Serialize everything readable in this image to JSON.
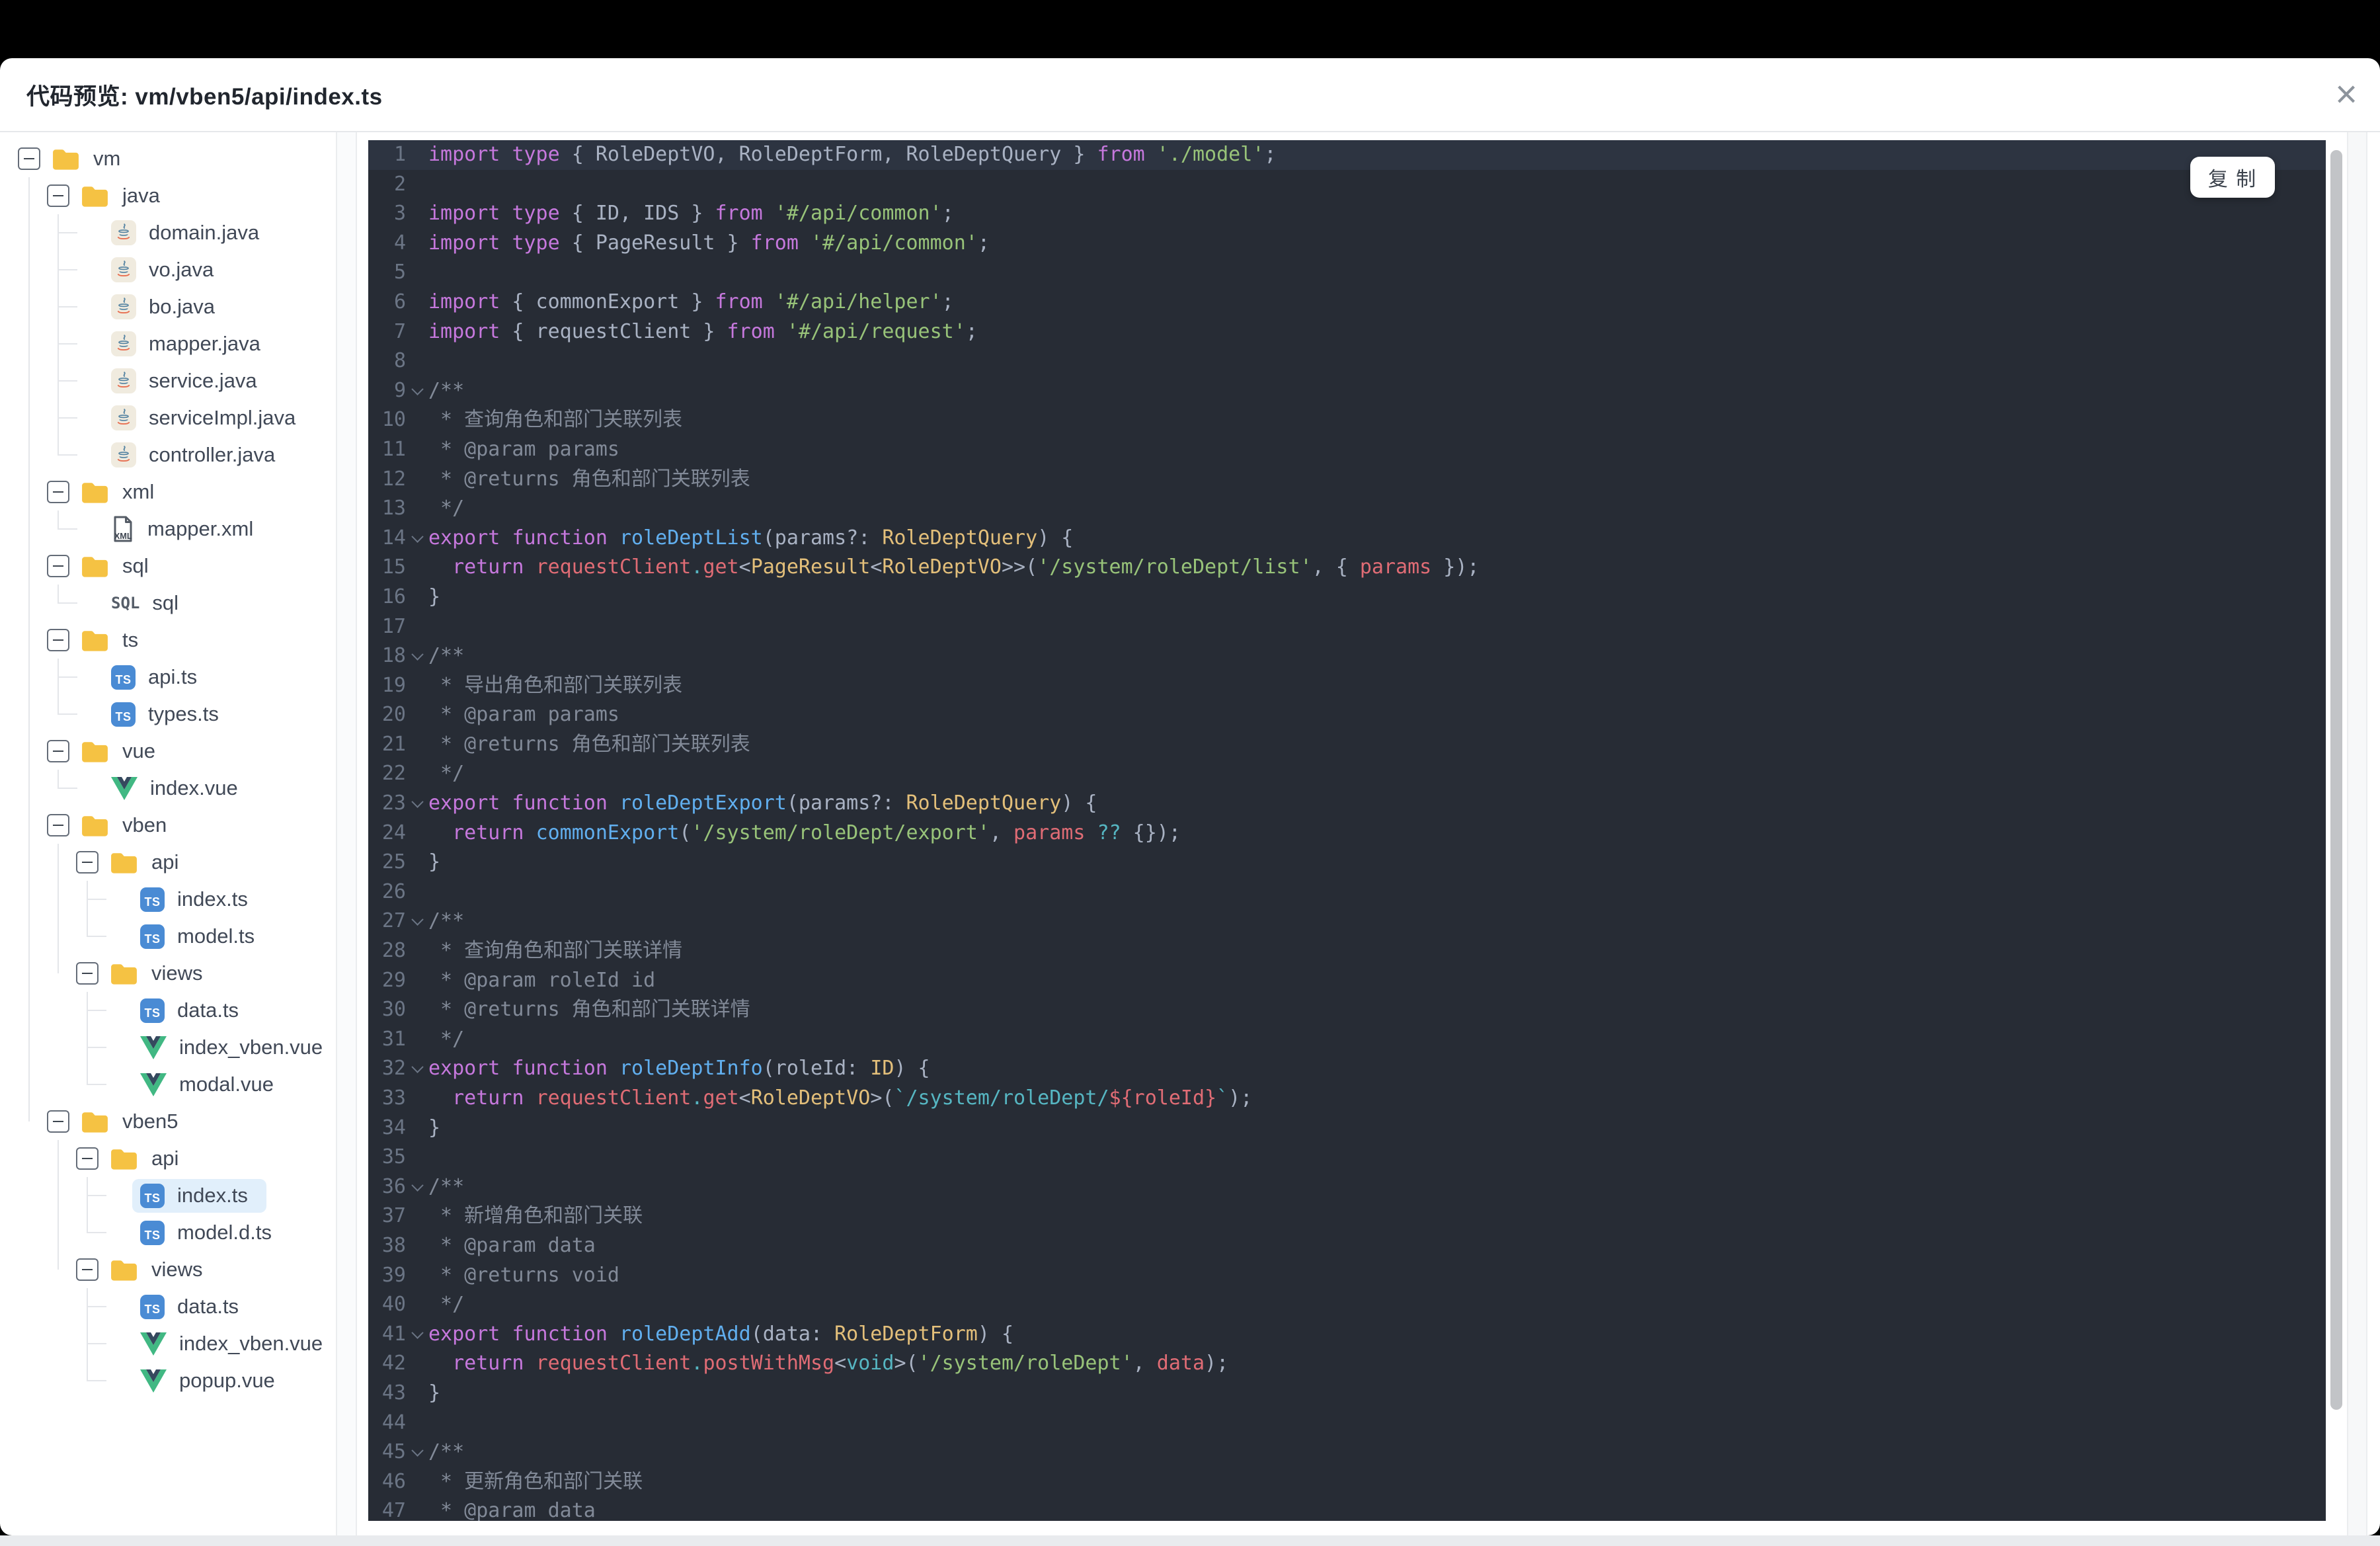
{
  "header": {
    "title": "代码预览: vm/vben5/api/index.ts",
    "close_label": "×"
  },
  "colors": {
    "bg": "#272c35",
    "hlbg": "#2d3441",
    "ln": "#6b7585",
    "default": "#a9b2c3",
    "keyword": "#c678dd",
    "string": "#98c379",
    "type": "#e3bf7a",
    "func": "#61afef",
    "variable": "#e06c75",
    "operator": "#56b6c2",
    "comment": "#828a98",
    "selected_row_bg": "#e1effb",
    "folder_icon": "#f5c243",
    "ts_icon_bg": "#4a8bd4",
    "vue_icon_green": "#41b883",
    "vue_icon_dark": "#35495e"
  },
  "tree": {
    "items": [
      {
        "depth": 0,
        "type": "folder",
        "icon": "folder",
        "label": "vm"
      },
      {
        "depth": 1,
        "type": "folder",
        "icon": "folder",
        "label": "java"
      },
      {
        "depth": 2,
        "type": "file",
        "icon": "java",
        "label": "domain.java"
      },
      {
        "depth": 2,
        "type": "file",
        "icon": "java",
        "label": "vo.java"
      },
      {
        "depth": 2,
        "type": "file",
        "icon": "java",
        "label": "bo.java"
      },
      {
        "depth": 2,
        "type": "file",
        "icon": "java",
        "label": "mapper.java"
      },
      {
        "depth": 2,
        "type": "file",
        "icon": "java",
        "label": "service.java"
      },
      {
        "depth": 2,
        "type": "file",
        "icon": "java",
        "label": "serviceImpl.java"
      },
      {
        "depth": 2,
        "type": "file",
        "icon": "java",
        "label": "controller.java",
        "last": true
      },
      {
        "depth": 1,
        "type": "folder",
        "icon": "folder",
        "label": "xml"
      },
      {
        "depth": 2,
        "type": "file",
        "icon": "xml",
        "label": "mapper.xml",
        "last": true
      },
      {
        "depth": 1,
        "type": "folder",
        "icon": "folder",
        "label": "sql"
      },
      {
        "depth": 2,
        "type": "file",
        "icon": "sql",
        "label": "sql",
        "last": true
      },
      {
        "depth": 1,
        "type": "folder",
        "icon": "folder",
        "label": "ts"
      },
      {
        "depth": 2,
        "type": "file",
        "icon": "ts",
        "label": "api.ts"
      },
      {
        "depth": 2,
        "type": "file",
        "icon": "ts",
        "label": "types.ts",
        "last": true
      },
      {
        "depth": 1,
        "type": "folder",
        "icon": "folder",
        "label": "vue"
      },
      {
        "depth": 2,
        "type": "file",
        "icon": "vue",
        "label": "index.vue",
        "last": true
      },
      {
        "depth": 1,
        "type": "folder",
        "icon": "folder",
        "label": "vben"
      },
      {
        "depth": 2,
        "type": "folder",
        "icon": "folder",
        "label": "api"
      },
      {
        "depth": 3,
        "type": "file",
        "icon": "ts",
        "label": "index.ts"
      },
      {
        "depth": 3,
        "type": "file",
        "icon": "ts",
        "label": "model.ts",
        "last": true
      },
      {
        "depth": 2,
        "type": "folder",
        "icon": "folder",
        "label": "views",
        "last": true
      },
      {
        "depth": 3,
        "type": "file",
        "icon": "ts",
        "label": "data.ts"
      },
      {
        "depth": 3,
        "type": "file",
        "icon": "vue",
        "label": "index_vben.vue"
      },
      {
        "depth": 3,
        "type": "file",
        "icon": "vue",
        "label": "modal.vue",
        "last": true
      },
      {
        "depth": 1,
        "type": "folder",
        "icon": "folder",
        "label": "vben5",
        "last": true
      },
      {
        "depth": 2,
        "type": "folder",
        "icon": "folder",
        "label": "api"
      },
      {
        "depth": 3,
        "type": "file",
        "icon": "ts",
        "label": "index.ts",
        "selected": true
      },
      {
        "depth": 3,
        "type": "file",
        "icon": "ts",
        "label": "model.d.ts",
        "last": true
      },
      {
        "depth": 2,
        "type": "folder",
        "icon": "folder",
        "label": "views",
        "last": true
      },
      {
        "depth": 3,
        "type": "file",
        "icon": "ts",
        "label": "data.ts"
      },
      {
        "depth": 3,
        "type": "file",
        "icon": "vue",
        "label": "index_vben.vue"
      },
      {
        "depth": 3,
        "type": "file",
        "icon": "vue",
        "label": "popup.vue",
        "last": true
      }
    ]
  },
  "code": {
    "copy_label": "复 制",
    "lines": [
      {
        "n": 1,
        "hl": true,
        "segs": [
          [
            "k",
            "import"
          ],
          [
            "d",
            " "
          ],
          [
            "k",
            "type"
          ],
          [
            "d",
            " { RoleDeptVO, RoleDeptForm, RoleDeptQuery } "
          ],
          [
            "k",
            "from"
          ],
          [
            "d",
            " "
          ],
          [
            "s",
            "'./model'"
          ],
          [
            "d",
            ";"
          ]
        ]
      },
      {
        "n": 2,
        "segs": []
      },
      {
        "n": 3,
        "segs": [
          [
            "k",
            "import"
          ],
          [
            "d",
            " "
          ],
          [
            "k",
            "type"
          ],
          [
            "d",
            " { ID, IDS } "
          ],
          [
            "k",
            "from"
          ],
          [
            "d",
            " "
          ],
          [
            "s",
            "'#/api/common'"
          ],
          [
            "d",
            ";"
          ]
        ]
      },
      {
        "n": 4,
        "segs": [
          [
            "k",
            "import"
          ],
          [
            "d",
            " "
          ],
          [
            "k",
            "type"
          ],
          [
            "d",
            " { PageResult } "
          ],
          [
            "k",
            "from"
          ],
          [
            "d",
            " "
          ],
          [
            "s",
            "'#/api/common'"
          ],
          [
            "d",
            ";"
          ]
        ]
      },
      {
        "n": 5,
        "segs": []
      },
      {
        "n": 6,
        "segs": [
          [
            "k",
            "import"
          ],
          [
            "d",
            " { commonExport } "
          ],
          [
            "k",
            "from"
          ],
          [
            "d",
            " "
          ],
          [
            "s",
            "'#/api/helper'"
          ],
          [
            "d",
            ";"
          ]
        ]
      },
      {
        "n": 7,
        "segs": [
          [
            "k",
            "import"
          ],
          [
            "d",
            " { requestClient } "
          ],
          [
            "k",
            "from"
          ],
          [
            "d",
            " "
          ],
          [
            "s",
            "'#/api/request'"
          ],
          [
            "d",
            ";"
          ]
        ]
      },
      {
        "n": 8,
        "segs": []
      },
      {
        "n": 9,
        "fold": true,
        "segs": [
          [
            "m",
            "/**"
          ]
        ]
      },
      {
        "n": 10,
        "segs": [
          [
            "m",
            " * 查询角色和部门关联列表"
          ]
        ]
      },
      {
        "n": 11,
        "segs": [
          [
            "m",
            " * @param params"
          ]
        ]
      },
      {
        "n": 12,
        "segs": [
          [
            "m",
            " * @returns 角色和部门关联列表"
          ]
        ]
      },
      {
        "n": 13,
        "segs": [
          [
            "m",
            " */"
          ]
        ]
      },
      {
        "n": 14,
        "fold": true,
        "segs": [
          [
            "k",
            "export"
          ],
          [
            "d",
            " "
          ],
          [
            "k",
            "function"
          ],
          [
            "d",
            " "
          ],
          [
            "f",
            "roleDeptList"
          ],
          [
            "d",
            "(params?: "
          ],
          [
            "t",
            "RoleDeptQuery"
          ],
          [
            "d",
            ") {"
          ]
        ]
      },
      {
        "n": 15,
        "segs": [
          [
            "d",
            "  "
          ],
          [
            "k",
            "return"
          ],
          [
            "d",
            " "
          ],
          [
            "r",
            "requestClient"
          ],
          [
            "c",
            "."
          ],
          [
            "r",
            "get"
          ],
          [
            "d",
            "<"
          ],
          [
            "t",
            "PageResult"
          ],
          [
            "d",
            "<"
          ],
          [
            "t",
            "RoleDeptVO"
          ],
          [
            "d",
            ">>("
          ],
          [
            "s",
            "'/system/roleDept/list'"
          ],
          [
            "d",
            ", { "
          ],
          [
            "r",
            "params"
          ],
          [
            "d",
            " });"
          ]
        ]
      },
      {
        "n": 16,
        "segs": [
          [
            "d",
            "}"
          ]
        ]
      },
      {
        "n": 17,
        "segs": []
      },
      {
        "n": 18,
        "fold": true,
        "segs": [
          [
            "m",
            "/**"
          ]
        ]
      },
      {
        "n": 19,
        "segs": [
          [
            "m",
            " * 导出角色和部门关联列表"
          ]
        ]
      },
      {
        "n": 20,
        "segs": [
          [
            "m",
            " * @param params"
          ]
        ]
      },
      {
        "n": 21,
        "segs": [
          [
            "m",
            " * @returns 角色和部门关联列表"
          ]
        ]
      },
      {
        "n": 22,
        "segs": [
          [
            "m",
            " */"
          ]
        ]
      },
      {
        "n": 23,
        "fold": true,
        "segs": [
          [
            "k",
            "export"
          ],
          [
            "d",
            " "
          ],
          [
            "k",
            "function"
          ],
          [
            "d",
            " "
          ],
          [
            "f",
            "roleDeptExport"
          ],
          [
            "d",
            "(params?: "
          ],
          [
            "t",
            "RoleDeptQuery"
          ],
          [
            "d",
            ") {"
          ]
        ]
      },
      {
        "n": 24,
        "segs": [
          [
            "d",
            "  "
          ],
          [
            "k",
            "return"
          ],
          [
            "d",
            " "
          ],
          [
            "f",
            "commonExport"
          ],
          [
            "d",
            "("
          ],
          [
            "s",
            "'/system/roleDept/export'"
          ],
          [
            "d",
            ", "
          ],
          [
            "r",
            "params"
          ],
          [
            "d",
            " "
          ],
          [
            "c",
            "??"
          ],
          [
            "d",
            " {});"
          ]
        ]
      },
      {
        "n": 25,
        "segs": [
          [
            "d",
            "}"
          ]
        ]
      },
      {
        "n": 26,
        "segs": []
      },
      {
        "n": 27,
        "fold": true,
        "segs": [
          [
            "m",
            "/**"
          ]
        ]
      },
      {
        "n": 28,
        "segs": [
          [
            "m",
            " * 查询角色和部门关联详情"
          ]
        ]
      },
      {
        "n": 29,
        "segs": [
          [
            "m",
            " * @param roleId id"
          ]
        ]
      },
      {
        "n": 30,
        "segs": [
          [
            "m",
            " * @returns 角色和部门关联详情"
          ]
        ]
      },
      {
        "n": 31,
        "segs": [
          [
            "m",
            " */"
          ]
        ]
      },
      {
        "n": 32,
        "fold": true,
        "segs": [
          [
            "k",
            "export"
          ],
          [
            "d",
            " "
          ],
          [
            "k",
            "function"
          ],
          [
            "d",
            " "
          ],
          [
            "f",
            "roleDeptInfo"
          ],
          [
            "d",
            "(roleId: "
          ],
          [
            "t",
            "ID"
          ],
          [
            "d",
            ") {"
          ]
        ]
      },
      {
        "n": 33,
        "segs": [
          [
            "d",
            "  "
          ],
          [
            "k",
            "return"
          ],
          [
            "d",
            " "
          ],
          [
            "r",
            "requestClient"
          ],
          [
            "c",
            "."
          ],
          [
            "r",
            "get"
          ],
          [
            "d",
            "<"
          ],
          [
            "t",
            "RoleDeptVO"
          ],
          [
            "d",
            ">("
          ],
          [
            "c",
            "`/system/roleDept/"
          ],
          [
            "r",
            "${roleId}"
          ],
          [
            "c",
            "`"
          ],
          [
            "d",
            ");"
          ]
        ]
      },
      {
        "n": 34,
        "segs": [
          [
            "d",
            "}"
          ]
        ]
      },
      {
        "n": 35,
        "segs": []
      },
      {
        "n": 36,
        "fold": true,
        "segs": [
          [
            "m",
            "/**"
          ]
        ]
      },
      {
        "n": 37,
        "segs": [
          [
            "m",
            " * 新增角色和部门关联"
          ]
        ]
      },
      {
        "n": 38,
        "segs": [
          [
            "m",
            " * @param data"
          ]
        ]
      },
      {
        "n": 39,
        "segs": [
          [
            "m",
            " * @returns void"
          ]
        ]
      },
      {
        "n": 40,
        "segs": [
          [
            "m",
            " */"
          ]
        ]
      },
      {
        "n": 41,
        "fold": true,
        "segs": [
          [
            "k",
            "export"
          ],
          [
            "d",
            " "
          ],
          [
            "k",
            "function"
          ],
          [
            "d",
            " "
          ],
          [
            "f",
            "roleDeptAdd"
          ],
          [
            "d",
            "(data: "
          ],
          [
            "t",
            "RoleDeptForm"
          ],
          [
            "d",
            ") {"
          ]
        ]
      },
      {
        "n": 42,
        "segs": [
          [
            "d",
            "  "
          ],
          [
            "k",
            "return"
          ],
          [
            "d",
            " "
          ],
          [
            "r",
            "requestClient"
          ],
          [
            "c",
            "."
          ],
          [
            "r",
            "postWithMsg"
          ],
          [
            "d",
            "<"
          ],
          [
            "c",
            "void"
          ],
          [
            "d",
            ">("
          ],
          [
            "s",
            "'/system/roleDept'"
          ],
          [
            "d",
            ", "
          ],
          [
            "r",
            "data"
          ],
          [
            "d",
            ");"
          ]
        ]
      },
      {
        "n": 43,
        "segs": [
          [
            "d",
            "}"
          ]
        ]
      },
      {
        "n": 44,
        "segs": []
      },
      {
        "n": 45,
        "fold": true,
        "segs": [
          [
            "m",
            "/**"
          ]
        ]
      },
      {
        "n": 46,
        "segs": [
          [
            "m",
            " * 更新角色和部门关联"
          ]
        ]
      },
      {
        "n": 47,
        "segs": [
          [
            "m",
            " * @param data"
          ]
        ]
      }
    ]
  }
}
